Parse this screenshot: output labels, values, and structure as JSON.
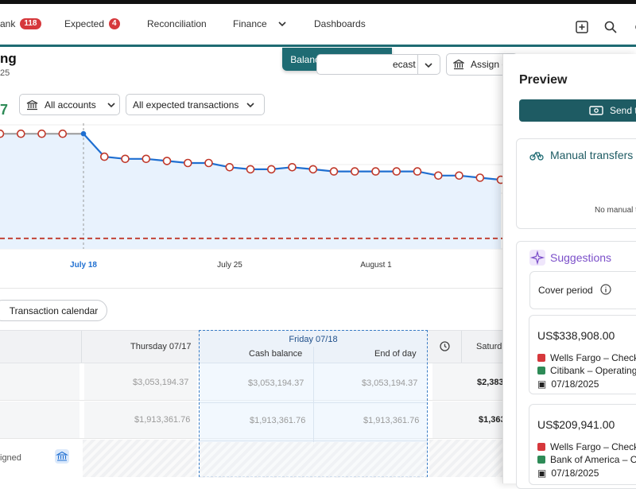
{
  "nav": {
    "items": [
      {
        "label": "ank",
        "badge": "118"
      },
      {
        "label": "Expected",
        "badge": "4"
      },
      {
        "label": "Reconciliation"
      },
      {
        "label": "Finance"
      },
      {
        "label": "Dashboards"
      }
    ]
  },
  "tooltip": {
    "label": "Balancing preview"
  },
  "page": {
    "title": "ng",
    "subtitle": "25"
  },
  "toolbar": {
    "forecast_label": "ecast",
    "assign_label": "Assign e"
  },
  "filters": {
    "accounts": "All accounts",
    "transactions": "All expected transactions"
  },
  "summary": {
    "value": "7"
  },
  "chart_data": {
    "type": "line",
    "x_ticks": [
      "July 18",
      "July 25",
      "August 1"
    ],
    "values": [
      3.05,
      3.05,
      3.05,
      3.05,
      3.05,
      2.94,
      2.93,
      2.93,
      2.92,
      2.91,
      2.91,
      2.89,
      2.88,
      2.88,
      2.89,
      2.88,
      2.87,
      2.87,
      2.87,
      2.87,
      2.87,
      2.85,
      2.85,
      2.84,
      2.83
    ],
    "threshold": 2.55,
    "colors": {
      "line": "#1f6fd1",
      "marker_edge": "#c0392b",
      "threshold": "#c0392b",
      "area": "#e8f2fd"
    }
  },
  "tabs": {
    "calendar": "Transaction calendar"
  },
  "table": {
    "headers": {
      "thursday": "Thursday 07/17",
      "friday": "Friday 07/18",
      "cash_balance": "Cash balance",
      "end_of_day": "End of day",
      "saturday": "Saturd"
    },
    "rows": [
      {
        "thu": "$3,053,194.37",
        "cash": "$3,053,194.37",
        "eod": "$3,053,194.37",
        "sat": "$2,383"
      },
      {
        "thu": "$1,913,361.76",
        "cash": "$1,913,361.76",
        "eod": "$1,913,361.76",
        "sat": "$1,363"
      }
    ],
    "unassigned_label": "igned"
  },
  "preview": {
    "title": "Preview",
    "send_label": "Send t",
    "manual": {
      "title": "Manual transfers",
      "empty": "No manual tran"
    },
    "suggestions": {
      "title": "Suggestions",
      "cover_period": "Cover period",
      "items": [
        {
          "amount": "US$338,908.00",
          "from": "Wells Fargo – Check",
          "to": "Citibank – Operating",
          "date": "07/18/2025"
        },
        {
          "amount": "US$209,941.00",
          "from": "Wells Fargo – Check",
          "to": "Bank of America – C",
          "date": "07/18/2025"
        }
      ]
    }
  }
}
